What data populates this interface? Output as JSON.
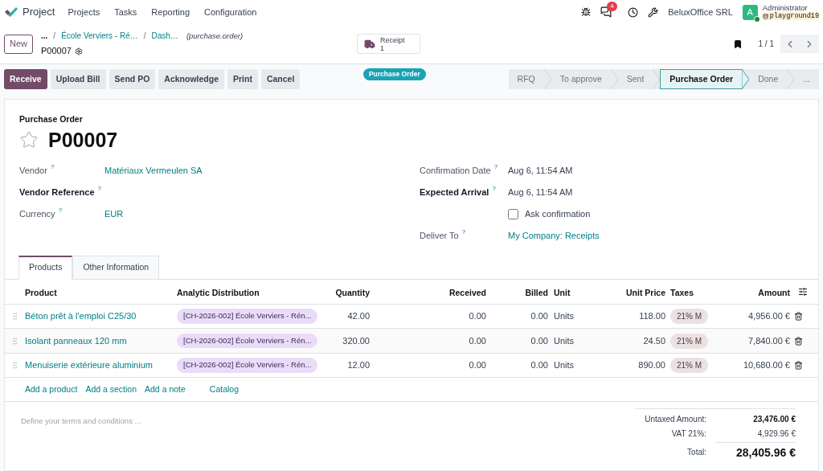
{
  "topbar": {
    "app_name": "Project",
    "menu": [
      "Projects",
      "Tasks",
      "Reporting",
      "Configuration"
    ],
    "notification_count": "4",
    "company": "BeluxOffice SRL",
    "avatar_letter": "A",
    "user_name": "Administrator",
    "database": "playground19"
  },
  "control": {
    "new_button": "New",
    "breadcrumb": [
      {
        "kind": "more",
        "text": "..."
      },
      {
        "kind": "separator",
        "text": "/"
      },
      {
        "kind": "link",
        "text": "École Verviers - Ré…"
      },
      {
        "kind": "separator",
        "text": "/"
      },
      {
        "kind": "link",
        "text": "Dash…"
      }
    ],
    "model": "(purchase.order)",
    "record": "P00007",
    "smart_button": {
      "label": "Receipt",
      "count": "1"
    },
    "pager": "1 / 1"
  },
  "actions": [
    {
      "label": "Receive",
      "primary": true
    },
    {
      "label": "Upload Bill",
      "primary": false
    },
    {
      "label": "Send PO",
      "primary": false
    },
    {
      "label": "Acknowledge",
      "primary": false
    },
    {
      "label": "Print",
      "primary": false
    },
    {
      "label": "Cancel",
      "primary": false
    }
  ],
  "status_badge": "Purchase Order",
  "stages": [
    {
      "label": "RFQ",
      "selected": false
    },
    {
      "label": "To approve",
      "selected": false
    },
    {
      "label": "Sent",
      "selected": false
    },
    {
      "label": "Purchase Order",
      "selected": true
    },
    {
      "label": "Done",
      "selected": false
    },
    {
      "label": "...",
      "selected": false
    }
  ],
  "form": {
    "title_label": "Purchase Order",
    "name": "P00007",
    "starred": false,
    "left_fields": [
      {
        "label": "Vendor",
        "help": "?",
        "required": false,
        "kind": "link",
        "value": "Matériaux Vermeulen SA"
      },
      {
        "label": "Vendor Reference",
        "help": "?",
        "required": true,
        "kind": "text"
      },
      {
        "label": "Currency",
        "help": "?",
        "required": false,
        "kind": "link",
        "value": "EUR"
      }
    ],
    "right_fields": [
      {
        "label": "Confirmation Date",
        "help": "?",
        "required": false,
        "kind": "text",
        "value": "Aug 6, 11:54 AM"
      },
      {
        "label": "Expected Arrival",
        "help": "?",
        "required": true,
        "kind": "text",
        "value": "Aug 6, 11:54 AM"
      },
      {
        "kind": "checkbox",
        "value": "Ask confirmation",
        "checked": false
      },
      {
        "label": "Deliver To",
        "help": "?",
        "required": false,
        "kind": "link",
        "value": "My Company: Receipts"
      }
    ]
  },
  "tabs": [
    {
      "label": "Products",
      "selected": true
    },
    {
      "label": "Other Information",
      "selected": false
    }
  ],
  "table": {
    "columns": [
      "Product",
      "Analytic Distribution",
      "Quantity",
      "Received",
      "Billed",
      "Unit",
      "Unit Price",
      "Taxes",
      "Amount"
    ],
    "rows": [
      {
        "product": "Béton prêt à l'emploi C25/30",
        "analytic": "[CH-2026-002] École Verviers - Rén...",
        "quantity": "42.00",
        "received": "0.00",
        "billed": "0.00",
        "unit": "Units",
        "unit_price": "118.00",
        "tax": "21% M",
        "amount": "4,956.00 €"
      },
      {
        "product": "Isolant panneaux 120 mm",
        "analytic": "[CH-2026-002] École Verviers - Rén...",
        "quantity": "320.00",
        "received": "0.00",
        "billed": "0.00",
        "unit": "Units",
        "unit_price": "24.50",
        "tax": "21% M",
        "amount": "7,840.00 €"
      },
      {
        "product": "Menuiserie extérieure aluminium",
        "analytic": "[CH-2026-002] École Verviers - Rén...",
        "quantity": "12.00",
        "received": "0.00",
        "billed": "0.00",
        "unit": "Units",
        "unit_price": "890.00",
        "tax": "21% M",
        "amount": "10,680.00 €"
      }
    ],
    "add_links": [
      "Add a product",
      "Add a section",
      "Add a note",
      "Catalog"
    ]
  },
  "terms": {
    "placeholder": "Define your terms and conditions ..."
  },
  "totals": [
    {
      "kind": "subtotal",
      "label": "Untaxed Amount:",
      "value": "23,476.00 €"
    },
    {
      "kind": "tax",
      "label": "VAT 21%:",
      "value": "4,929.96 €"
    },
    {
      "kind": "total",
      "label": "Total:",
      "value": "28,405.96 €"
    }
  ]
}
